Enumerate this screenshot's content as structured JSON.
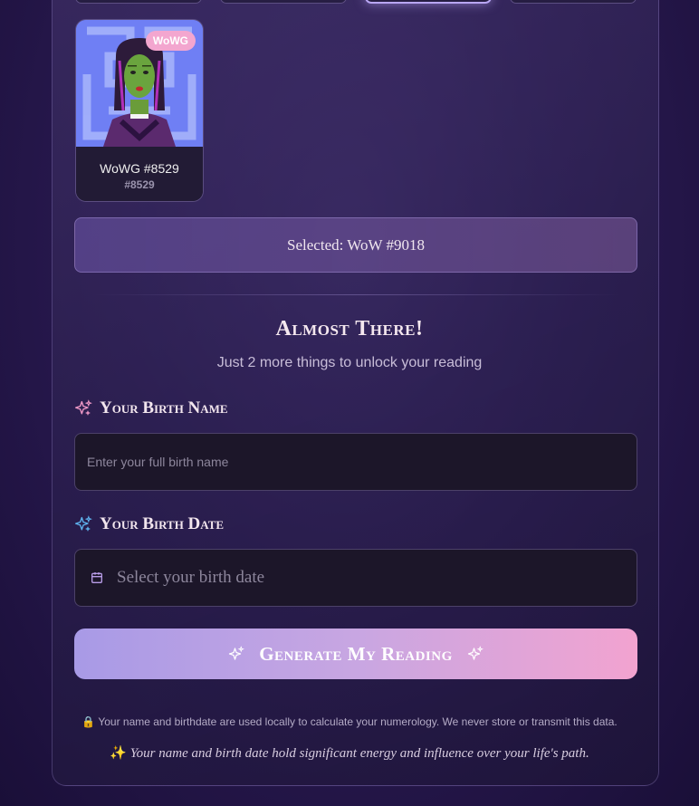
{
  "nft_card": {
    "badge": "WoWG",
    "name": "WoWG #8529",
    "id": "#8529",
    "art_icon": "gamora-portrait"
  },
  "selection": {
    "text": "Selected: WoW #9018"
  },
  "intro": {
    "heading": "Almost There!",
    "subheading": "Just 2 more things to unlock your reading"
  },
  "birth_name": {
    "label": "Your Birth Name",
    "icon": "sparkle-icon",
    "placeholder": "Enter your full birth name"
  },
  "birth_date": {
    "label": "Your Birth Date",
    "icon": "sparkle-icon",
    "calendar_icon": "calendar-icon",
    "placeholder": "Select your birth date"
  },
  "generate_button": {
    "label": "Generate My Reading"
  },
  "footer": {
    "privacy_icon": "lock-icon",
    "privacy_text": "Your name and birthdate are used locally to calculate your numerology. We never store or transmit this data.",
    "quote_icon": "sparkles-icon",
    "quote": "Your name and birth date hold significant energy and influence over your life's path."
  },
  "colors": {
    "accent_pink": "#f3a6cf",
    "accent_lavender": "#a89ae6",
    "field_bg": "#1c1629"
  }
}
